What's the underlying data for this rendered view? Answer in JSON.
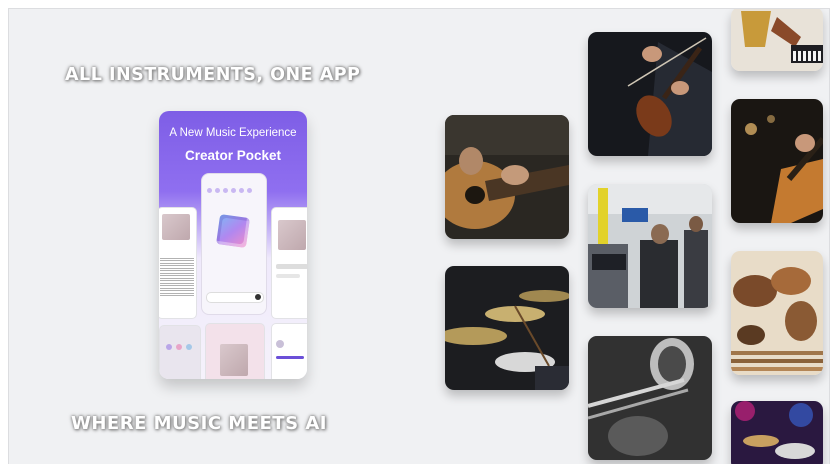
{
  "headline_top": "ALL INSTRUMENTS, ONE APP",
  "headline_bottom": "WHERE MUSIC MEETS AI",
  "promo": {
    "title": "A New Music Experience",
    "app_name": "Creator Pocket"
  },
  "photos": [
    {
      "name": "acoustic-guitar-photo"
    },
    {
      "name": "violin-photo"
    },
    {
      "name": "saxophone-keyboard-photo"
    },
    {
      "name": "electric-bass-photo"
    },
    {
      "name": "keyboard-booth-photo"
    },
    {
      "name": "drum-kit-photo"
    },
    {
      "name": "percussion-instruments-photo"
    },
    {
      "name": "trombone-photo"
    },
    {
      "name": "stage-drums-photo"
    }
  ],
  "colors": {
    "background": "#f0f1f3",
    "promo_purple": "#7e5ee6"
  }
}
